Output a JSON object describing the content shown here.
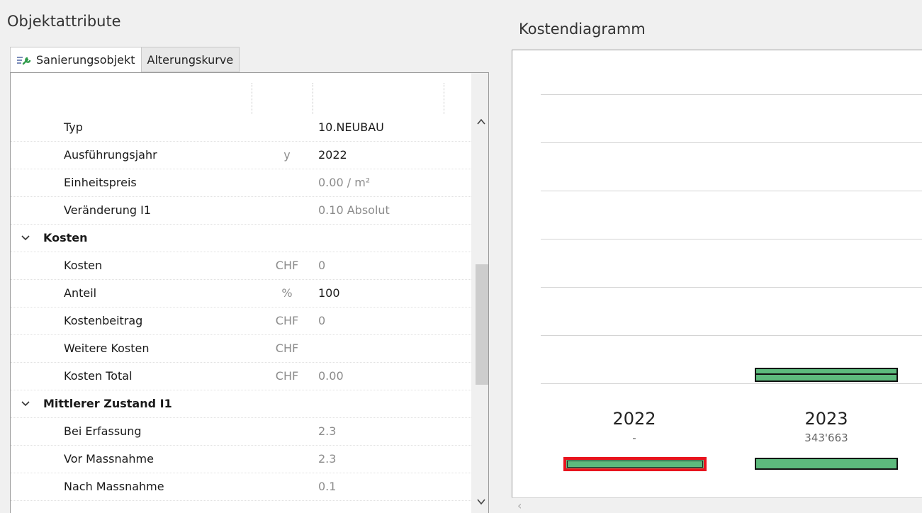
{
  "left_panel": {
    "title": "Objektattribute",
    "tabs": [
      {
        "label": "Sanierungsobjekt",
        "icon": "wrench-list-icon",
        "active": true
      },
      {
        "label": "Alterungskurve",
        "active": false
      }
    ],
    "rows": [
      {
        "name": "Typ",
        "unit": "",
        "value": "10.NEUBAU",
        "value_grey": false
      },
      {
        "name": "Ausführungsjahr",
        "unit": "y",
        "value": "2022",
        "value_grey": false
      },
      {
        "name": "Einheitspreis",
        "unit": "",
        "value": "0.00 / m²",
        "value_grey": true
      },
      {
        "name": "Veränderung I1",
        "unit": "",
        "value": "0.10 Absolut",
        "value_grey": true
      }
    ],
    "group_kosten": {
      "label": "Kosten",
      "rows": [
        {
          "name": "Kosten",
          "unit": "CHF",
          "value": "0",
          "value_grey": true
        },
        {
          "name": "Anteil",
          "unit": "%",
          "value": "100",
          "value_grey": false
        },
        {
          "name": "Kostenbeitrag",
          "unit": "CHF",
          "value": "0",
          "value_grey": true
        },
        {
          "name": "Weitere Kosten",
          "unit": "CHF",
          "value": "",
          "value_grey": true
        },
        {
          "name": "Kosten Total",
          "unit": "CHF",
          "value": "0.00",
          "value_grey": true
        }
      ]
    },
    "group_zustand": {
      "label": "Mittlerer Zustand I1",
      "rows": [
        {
          "name": "Bei Erfassung",
          "unit": "",
          "value": "2.3",
          "value_grey": true
        },
        {
          "name": "Vor Massnahme",
          "unit": "",
          "value": "2.3",
          "value_grey": true
        },
        {
          "name": "Nach Massnahme",
          "unit": "",
          "value": "0.1",
          "value_grey": true
        }
      ]
    }
  },
  "right_panel": {
    "title": "Kostendiagramm",
    "years": [
      {
        "label": "2022",
        "sub": "-",
        "selected": true
      },
      {
        "label": "2023",
        "sub": "343'663",
        "selected": false
      }
    ]
  },
  "colors": {
    "bar_fill": "#5dba7d",
    "selection": "#e8141e"
  }
}
